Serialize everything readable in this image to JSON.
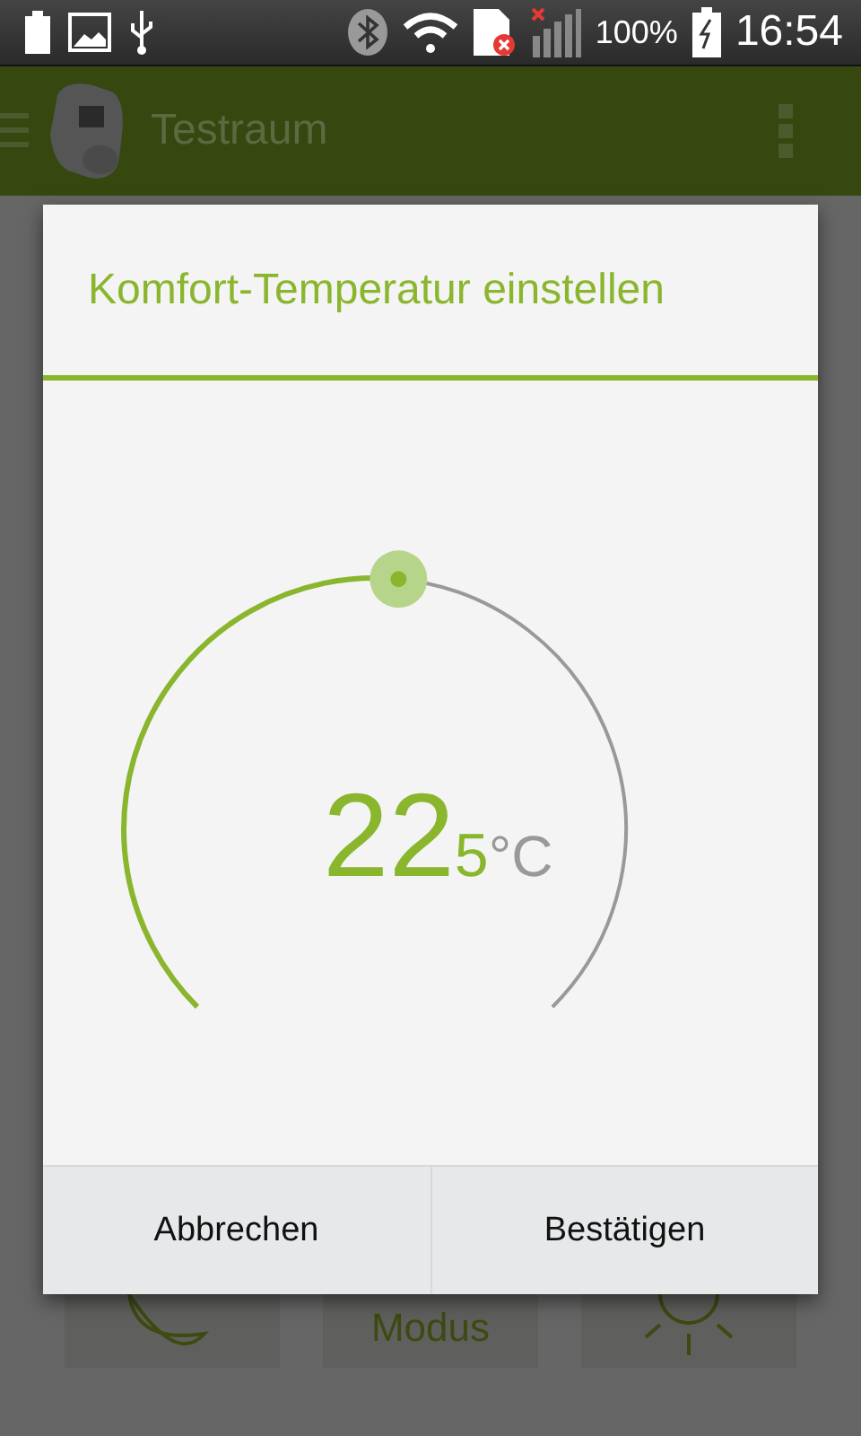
{
  "status_bar": {
    "battery_percent": "100%",
    "time": "16:54"
  },
  "app_bar": {
    "title": "Testraum"
  },
  "dialog": {
    "title": "Komfort-Temperatur einstellen",
    "reading": {
      "whole": "22",
      "fraction": "5",
      "unit": "°C"
    },
    "buttons": [
      {
        "label": "Abbrechen"
      },
      {
        "label": "Bestätigen"
      }
    ]
  },
  "tiles": [
    {
      "kind": "moon"
    },
    {
      "kind": "label",
      "label": "Modus"
    },
    {
      "kind": "sun"
    }
  ]
}
